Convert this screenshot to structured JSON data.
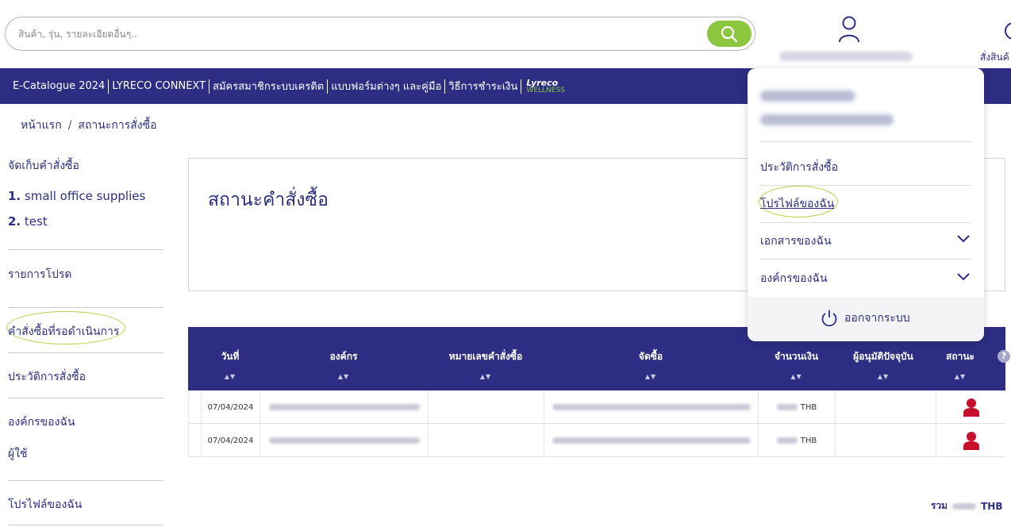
{
  "search": {
    "placeholder": "สินค้า, รุ่น, รายละเอียดอื่นๆ.."
  },
  "header": {
    "order_label": "สั่งสินค้"
  },
  "nav": {
    "items": [
      "E-Catalogue 2024",
      "LYRECO CONNEXT",
      "สมัครสมาชิกระบบเครดิต",
      "แบบฟอร์มต่างๆ และคู่มือ",
      "วิธีการชำระเงิน"
    ],
    "brand_top": "Lyreco",
    "brand_bottom": "WELLNESS"
  },
  "breadcrumb": {
    "home": "หน้าแรก",
    "separator": "/",
    "current": "สถานะการสั่งซื้อ"
  },
  "sidebar": {
    "saved_heading": "จัดเก็บคำสั่งซื้อ",
    "saved_lists": [
      {
        "num": "1.",
        "label": "small office supplies"
      },
      {
        "num": "2.",
        "label": "test"
      }
    ],
    "favorites": "รายการโปรด",
    "pending_orders": "คำสั่งซื้อที่รอดำเนินการ",
    "order_history": "ประวัติการสั่งซื้อ",
    "my_organization": "องค์กรของฉัน",
    "users": "ผู้ใช้",
    "my_profile": "โปรไฟล์ของฉัน"
  },
  "status_card": {
    "title": "สถานะคำสั่งซื้อ"
  },
  "table": {
    "columns": [
      "วันที่",
      "องค์กร",
      "หมายเลขคำสั่งซื้อ",
      "จัดซื้อ",
      "จำนวนเงิน",
      "ผู้อนุมัติปัจจุบัน",
      "สถานะ"
    ],
    "sort_glyph": "▲▼",
    "help_glyph": "?",
    "rows": [
      {
        "date": "07/04/2024",
        "currency": "THB"
      },
      {
        "date": "07/04/2024",
        "currency": "THB"
      }
    ],
    "total_label": "รวม",
    "total_currency": "THB"
  },
  "dropdown": {
    "order_history": "ประวัติการสั่งซื้อ",
    "my_profile": "โปรไฟล์ของฉัน",
    "my_documents": "เอกสารของฉัน",
    "my_organization": "องค์กรของฉัน",
    "logout": "ออกจากระบบ"
  },
  "colors": {
    "brand": "#2d2e83",
    "accent": "#8cc63f",
    "status_icon": "#c8102e"
  }
}
